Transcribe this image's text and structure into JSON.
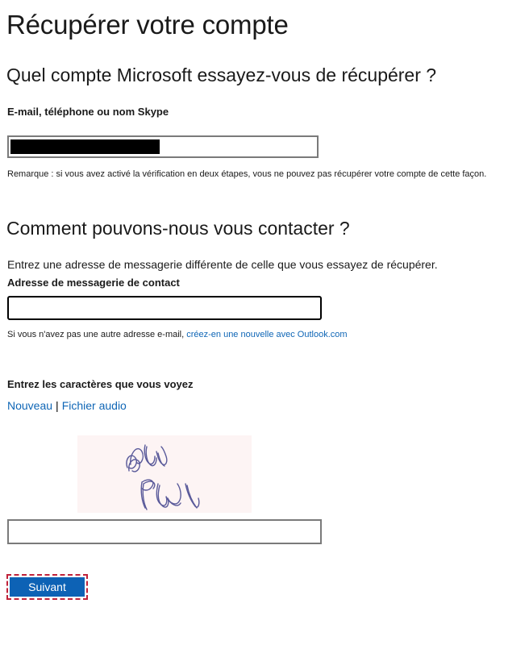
{
  "page": {
    "title": "Récupérer votre compte"
  },
  "account_section": {
    "heading": "Quel compte Microsoft essayez-vous de récupérer ?",
    "field_label": "E-mail, téléphone ou nom Skype",
    "field_value": "",
    "note": "Remarque : si vous avez activé la vérification en deux étapes, vous ne pouvez pas récupérer votre compte de cette façon."
  },
  "contact_section": {
    "heading": "Comment pouvons-nous vous contacter ?",
    "instruction": "Entrez une adresse de messagerie différente de celle que vous essayez de récupérer.",
    "field_label": "Adresse de messagerie de contact",
    "field_value": "",
    "hint_prefix": "Si vous n'avez pas une autre adresse e-mail, ",
    "hint_link": "créez-en une nouvelle avec Outlook.com"
  },
  "captcha": {
    "label": "Entrez les caractères que vous voyez",
    "new_link": "Nouveau",
    "separator": "|",
    "audio_link": "Fichier audio",
    "field_value": ""
  },
  "actions": {
    "next_label": "Suivant"
  },
  "colors": {
    "link": "#0f66b6",
    "button_bg": "#0d62b5",
    "focus_outline": "#c0223a",
    "captcha_ink": "#5a5a9a"
  }
}
